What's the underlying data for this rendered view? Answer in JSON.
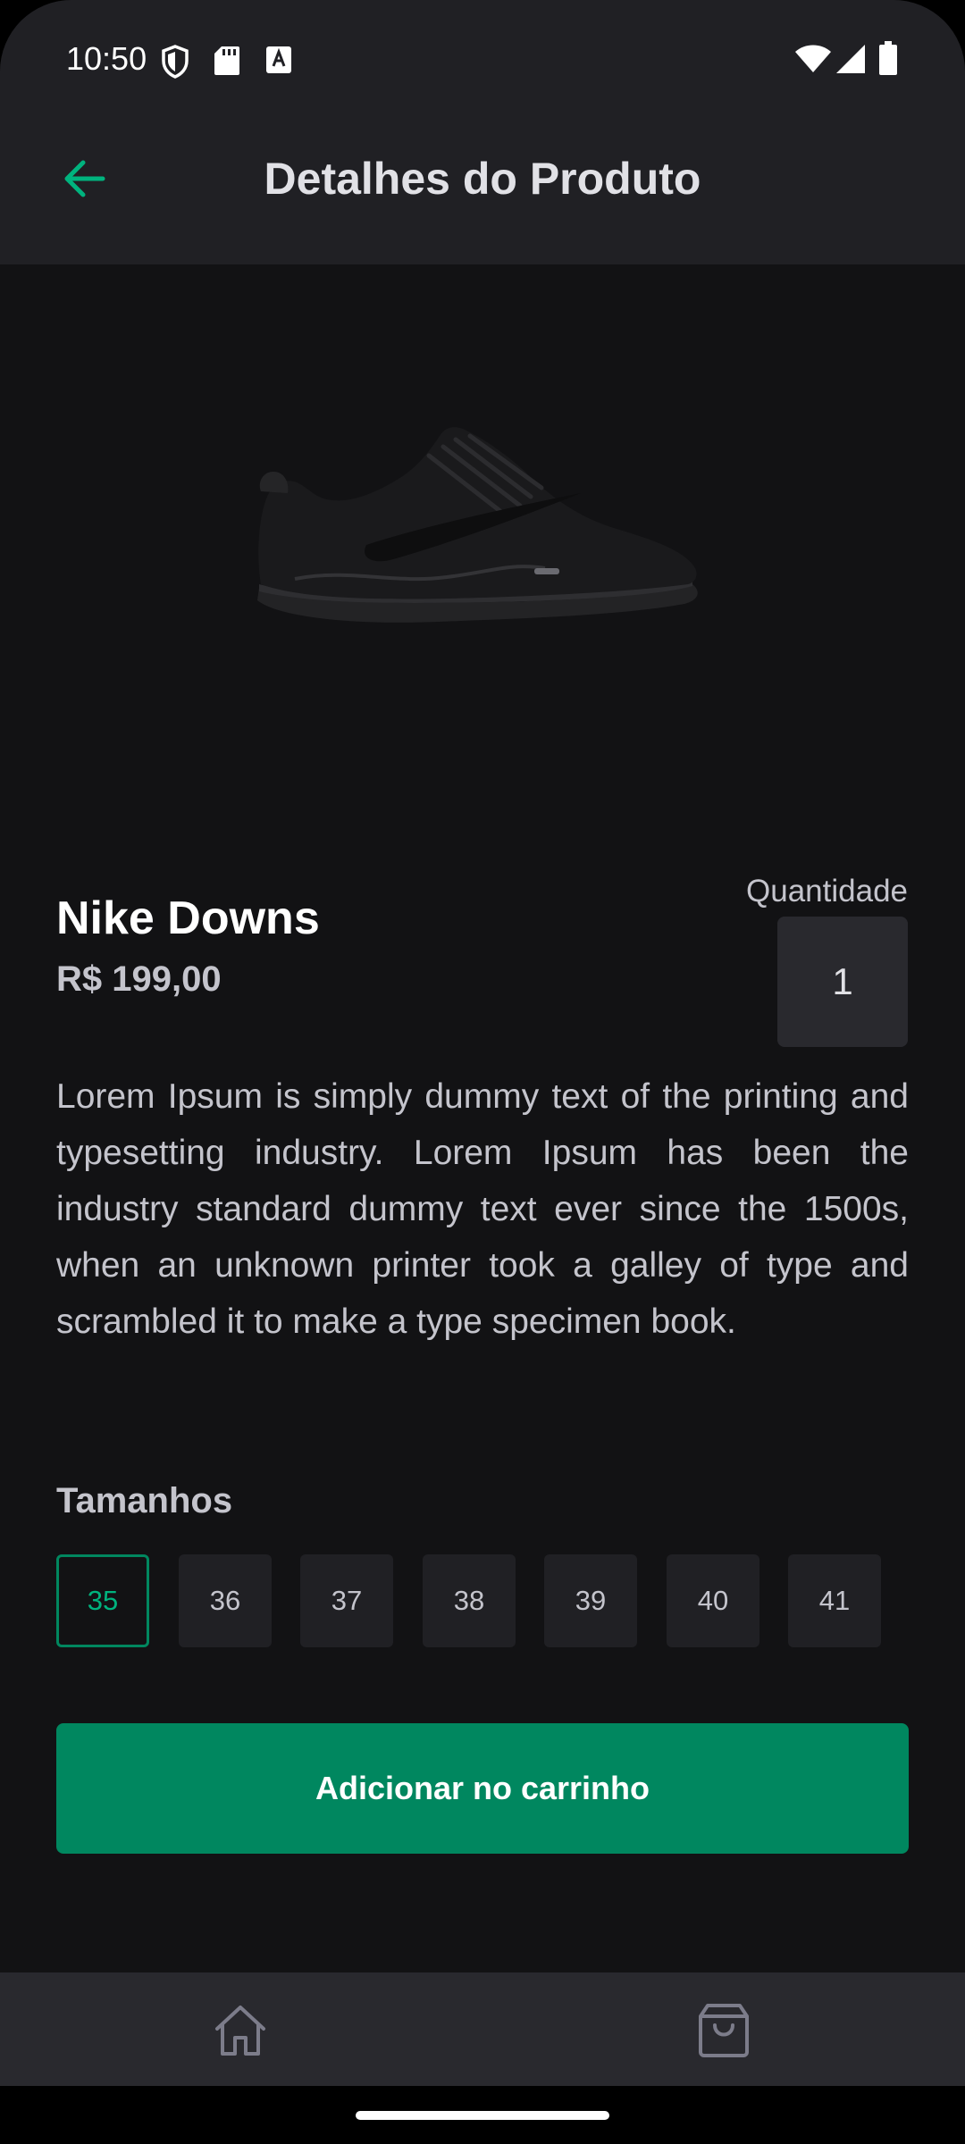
{
  "status_bar": {
    "time": "10:50"
  },
  "header": {
    "title": "Detalhes do Produto",
    "back_icon": "arrow-left-icon"
  },
  "product": {
    "name": "Nike Downs",
    "price": "R$ 199,00",
    "description": "Lorem Ipsum is simply dummy text of the printing and typesetting industry. Lorem Ipsum has been the industry standard dummy text ever since the 1500s, when an unknown printer took a galley of type and scrambled it to make a type specimen book.",
    "image": "sneaker-image"
  },
  "quantity": {
    "label": "Quantidade",
    "value": "1"
  },
  "sizes": {
    "title": "Tamanhos",
    "options": [
      "35",
      "36",
      "37",
      "38",
      "39",
      "40",
      "41"
    ],
    "selected": "35"
  },
  "cart_button": {
    "label": "Adicionar no carrinho"
  },
  "tab_bar": {
    "items": [
      {
        "icon": "home-icon"
      },
      {
        "icon": "shopping-bag-icon"
      }
    ]
  },
  "colors": {
    "accent": "#00875f",
    "accent_light": "#00b37e",
    "background": "#121214",
    "surface": "#202024",
    "surface_alt": "#29292e",
    "text_primary": "#e1e1e6",
    "text_secondary": "#c4c4cc"
  }
}
